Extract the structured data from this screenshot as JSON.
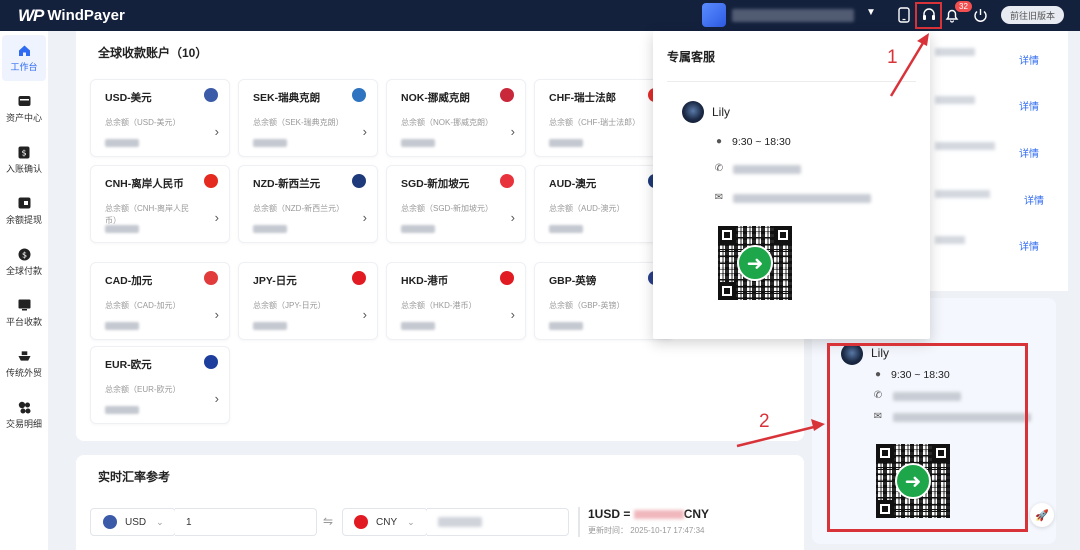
{
  "header": {
    "logo_mark": "WP",
    "logo_text": "WindPayer",
    "notification_count": "32",
    "old_version_label": "前往旧版本"
  },
  "sidebar": {
    "items": [
      {
        "label": "工作台",
        "icon": "home-icon"
      },
      {
        "label": "资产中心",
        "icon": "wallet-icon"
      },
      {
        "label": "入账确认",
        "icon": "deposit-icon"
      },
      {
        "label": "余额提现",
        "icon": "withdraw-icon"
      },
      {
        "label": "全球付款",
        "icon": "global-payment-icon"
      },
      {
        "label": "平台收款",
        "icon": "platform-icon"
      },
      {
        "label": "传统外贸",
        "icon": "ship-icon"
      },
      {
        "label": "交易明细",
        "icon": "transactions-icon"
      }
    ]
  },
  "accounts": {
    "title": "全球收款账户（10）",
    "cards": [
      {
        "name": "USD-美元",
        "sub": "总余额（USD-美元）",
        "flag": "#3b5aa8"
      },
      {
        "name": "SEK-瑞典克朗",
        "sub": "总余额（SEK-瑞典克朗）",
        "flag": "#2f74c0"
      },
      {
        "name": "NOK-挪威克朗",
        "sub": "总余额（NOK-挪威克朗）",
        "flag": "#c8283a"
      },
      {
        "name": "CHF-瑞士法郎",
        "sub": "总余额（CHF-瑞士法郎）",
        "flag": "#e32b2b"
      },
      {
        "name": "CNH-离岸人民币",
        "sub": "总余额（CNH-离岸人民币）",
        "flag": "#e52a1f"
      },
      {
        "name": "NZD-新西兰元",
        "sub": "总余额（NZD-新西兰元）",
        "flag": "#1f3a7a"
      },
      {
        "name": "SGD-新加坡元",
        "sub": "总余额（SGD-新加坡元）",
        "flag": "#e8333c"
      },
      {
        "name": "AUD-澳元",
        "sub": "总余额（AUD-澳元）",
        "flag": "#1f3a7a"
      },
      {
        "name": "CAD-加元",
        "sub": "总余额（CAD-加元）",
        "flag": "#e23b3b"
      },
      {
        "name": "JPY-日元",
        "sub": "总余额（JPY-日元）",
        "flag": "#e21b23"
      },
      {
        "name": "HKD-港币",
        "sub": "总余额（HKD-港币）",
        "flag": "#e21b23"
      },
      {
        "name": "GBP-英镑",
        "sub": "总余额（GBP-英镑）",
        "flag": "#2a3f8a"
      },
      {
        "name": "EUR-欧元",
        "sub": "总余额（EUR-欧元）",
        "flag": "#1d3e9c"
      }
    ]
  },
  "rates": {
    "title": "实时汇率参考",
    "from_currency": "USD",
    "from_amount": "1",
    "to_currency": "CNY",
    "result_prefix": "1USD =",
    "result_suffix": "CNY",
    "updated": "更新时间：  2025-10-17 17:47:34"
  },
  "right_column": {
    "detail_label": "详情"
  },
  "popup": {
    "title": "专属客服",
    "agent_name": "Lily",
    "hours": "9:30 ~ 18:30"
  },
  "embedded_card": {
    "agent_name": "Lily",
    "hours": "9:30 ~ 18:30"
  },
  "annotations": {
    "one": "1",
    "two": "2"
  }
}
